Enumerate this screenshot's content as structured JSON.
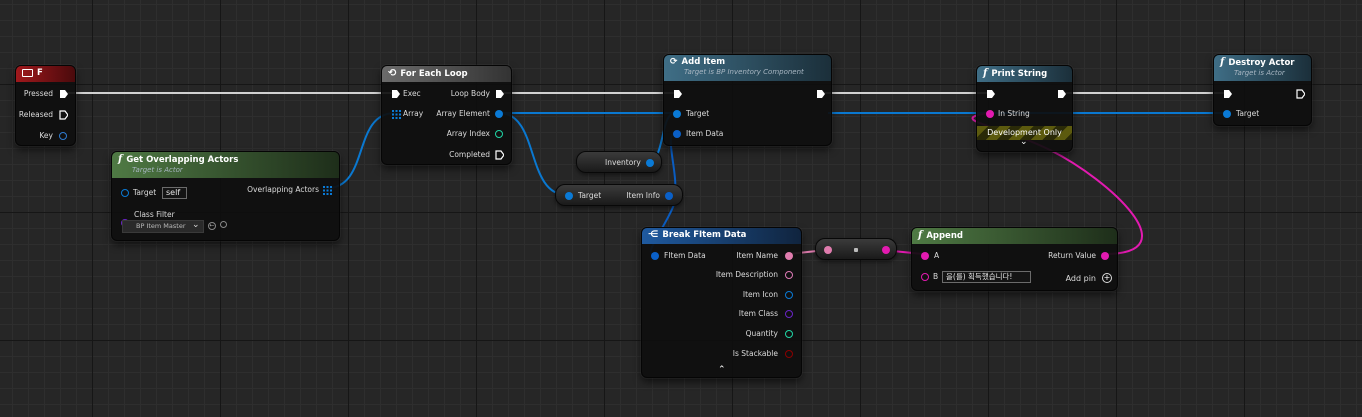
{
  "colors": {
    "exec": "#ffffff",
    "object": "#0a7ad6",
    "struct": "#0a60c8",
    "string": "#e21ab0",
    "name": "#e07cae",
    "text": "#de7ab6",
    "integer": "#20d6a6",
    "class": "#6a24c8",
    "bool": "#8c0000",
    "key": "#2f7cd2"
  },
  "nodes": {
    "key_f": {
      "title": "F",
      "pins": {
        "pressed": "Pressed",
        "released": "Released",
        "key": "Key"
      }
    },
    "get_overlapping": {
      "title": "Get Overlapping Actors",
      "subtitle": "Target is Actor",
      "pins": {
        "target": "Target",
        "target_value": "self",
        "class_filter": "Class Filter",
        "class_value": "BP Item Master",
        "overlapping": "Overlapping Actors"
      }
    },
    "for_each": {
      "title": "For Each Loop",
      "pins": {
        "exec": "Exec",
        "array": "Array",
        "loop_body": "Loop Body",
        "array_element": "Array Element",
        "array_index": "Array Index",
        "completed": "Completed"
      }
    },
    "add_item": {
      "title": "Add Item",
      "subtitle": "Target is BP Inventory Component",
      "pins": {
        "target": "Target",
        "item_data": "Item Data"
      }
    },
    "inventory_get": {
      "label": "Inventory"
    },
    "item_info_get": {
      "target": "Target",
      "item_info": "Item Info"
    },
    "break_data": {
      "title": "Break FItem Data",
      "pins": {
        "fitem_data": "FItem Data",
        "item_name": "Item Name",
        "item_description": "Item Description",
        "item_icon": "Item Icon",
        "item_class": "Item Class",
        "quantity": "Quantity",
        "is_stackable": "Is Stackable"
      }
    },
    "append": {
      "title": "Append",
      "pins": {
        "a": "A",
        "b": "B",
        "b_value": "을(를) 획득했습니다!",
        "return_value": "Return Value",
        "add_pin": "Add pin"
      }
    },
    "print_string": {
      "title": "Print String",
      "pins": {
        "in_string": "In String"
      },
      "development_only": "Development Only"
    },
    "destroy_actor": {
      "title": "Destroy Actor",
      "subtitle": "Target is Actor",
      "pins": {
        "target": "Target"
      }
    }
  }
}
